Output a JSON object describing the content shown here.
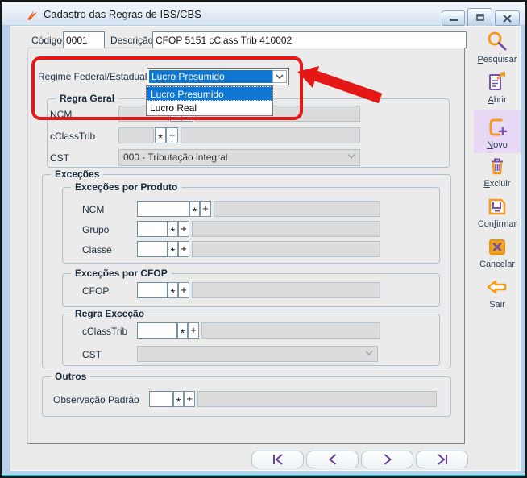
{
  "window": {
    "title": "Cadastro das Regras de IBS/CBS"
  },
  "titlebar_controls": [
    "minimize-icon",
    "restore-icon",
    "close-icon"
  ],
  "header": {
    "codigo_label": "Código",
    "codigo_value": "0001",
    "descricao_label": "Descrição",
    "descricao_value": "CFOP 5151 cClass Trib 410002"
  },
  "regime": {
    "label": "Regime Federal/Estadual",
    "value": "Lucro Presumido",
    "options": [
      {
        "label": "Lucro Presumido",
        "selected": true
      },
      {
        "label": "Lucro Real",
        "selected": false
      }
    ]
  },
  "lookup": {
    "star": "*",
    "plus": "+"
  },
  "regra_geral": {
    "title": "Regra Geral",
    "ncm_label": "NCM",
    "cclasstrib_label": "cClassTrib",
    "cst_label": "CST",
    "cst_value": "000 - Tributação integral"
  },
  "excecoes": {
    "title": "Exceções",
    "por_produto": {
      "title": "Exceções por Produto",
      "ncm_label": "NCM",
      "grupo_label": "Grupo",
      "classe_label": "Classe"
    },
    "por_cfop": {
      "title": "Exceções por CFOP",
      "cfop_label": "CFOP"
    },
    "regra_excecao": {
      "title": "Regra Exceção",
      "cclasstrib_label": "cClassTrib",
      "cst_label": "CST",
      "cst_value": ""
    }
  },
  "outros": {
    "title": "Outros",
    "observacao_label": "Observação Padrão"
  },
  "sidebar": {
    "buttons": [
      {
        "name": "pesquisar",
        "icon": "search-icon",
        "pre": "",
        "key": "P",
        "post": "esquisar"
      },
      {
        "name": "abrir",
        "icon": "open-document-icon",
        "pre": "",
        "key": "A",
        "post": "brir"
      },
      {
        "name": "novo",
        "icon": "new-document-icon",
        "pre": "",
        "key": "N",
        "post": "ovo",
        "active": true
      },
      {
        "name": "excluir",
        "icon": "trash-icon",
        "pre": "",
        "key": "E",
        "post": "xcluir"
      },
      {
        "name": "confirmar",
        "icon": "save-icon",
        "pre": "Con",
        "key": "f",
        "post": "irmar"
      },
      {
        "name": "cancelar",
        "icon": "cancel-icon",
        "pre": "",
        "key": "C",
        "post": "ancelar"
      },
      {
        "name": "sair",
        "icon": "exit-arrow-icon",
        "pre": "Sair",
        "key": "",
        "post": ""
      }
    ]
  },
  "nav": {
    "items": [
      {
        "name": "first-record-button",
        "icon": "first-record-icon"
      },
      {
        "name": "previous-record-button",
        "icon": "previous-record-icon"
      },
      {
        "name": "next-record-button",
        "icon": "next-record-icon"
      },
      {
        "name": "last-record-button",
        "icon": "last-record-icon"
      }
    ]
  },
  "colors": {
    "accent_orange": "#f59b22",
    "accent_purple": "#7a52a8",
    "selection_blue": "#0f77d2",
    "annotation_red": "#e41616",
    "novo_highlight": "#e7d8f6",
    "disabled_field": "#dcdcdc"
  }
}
